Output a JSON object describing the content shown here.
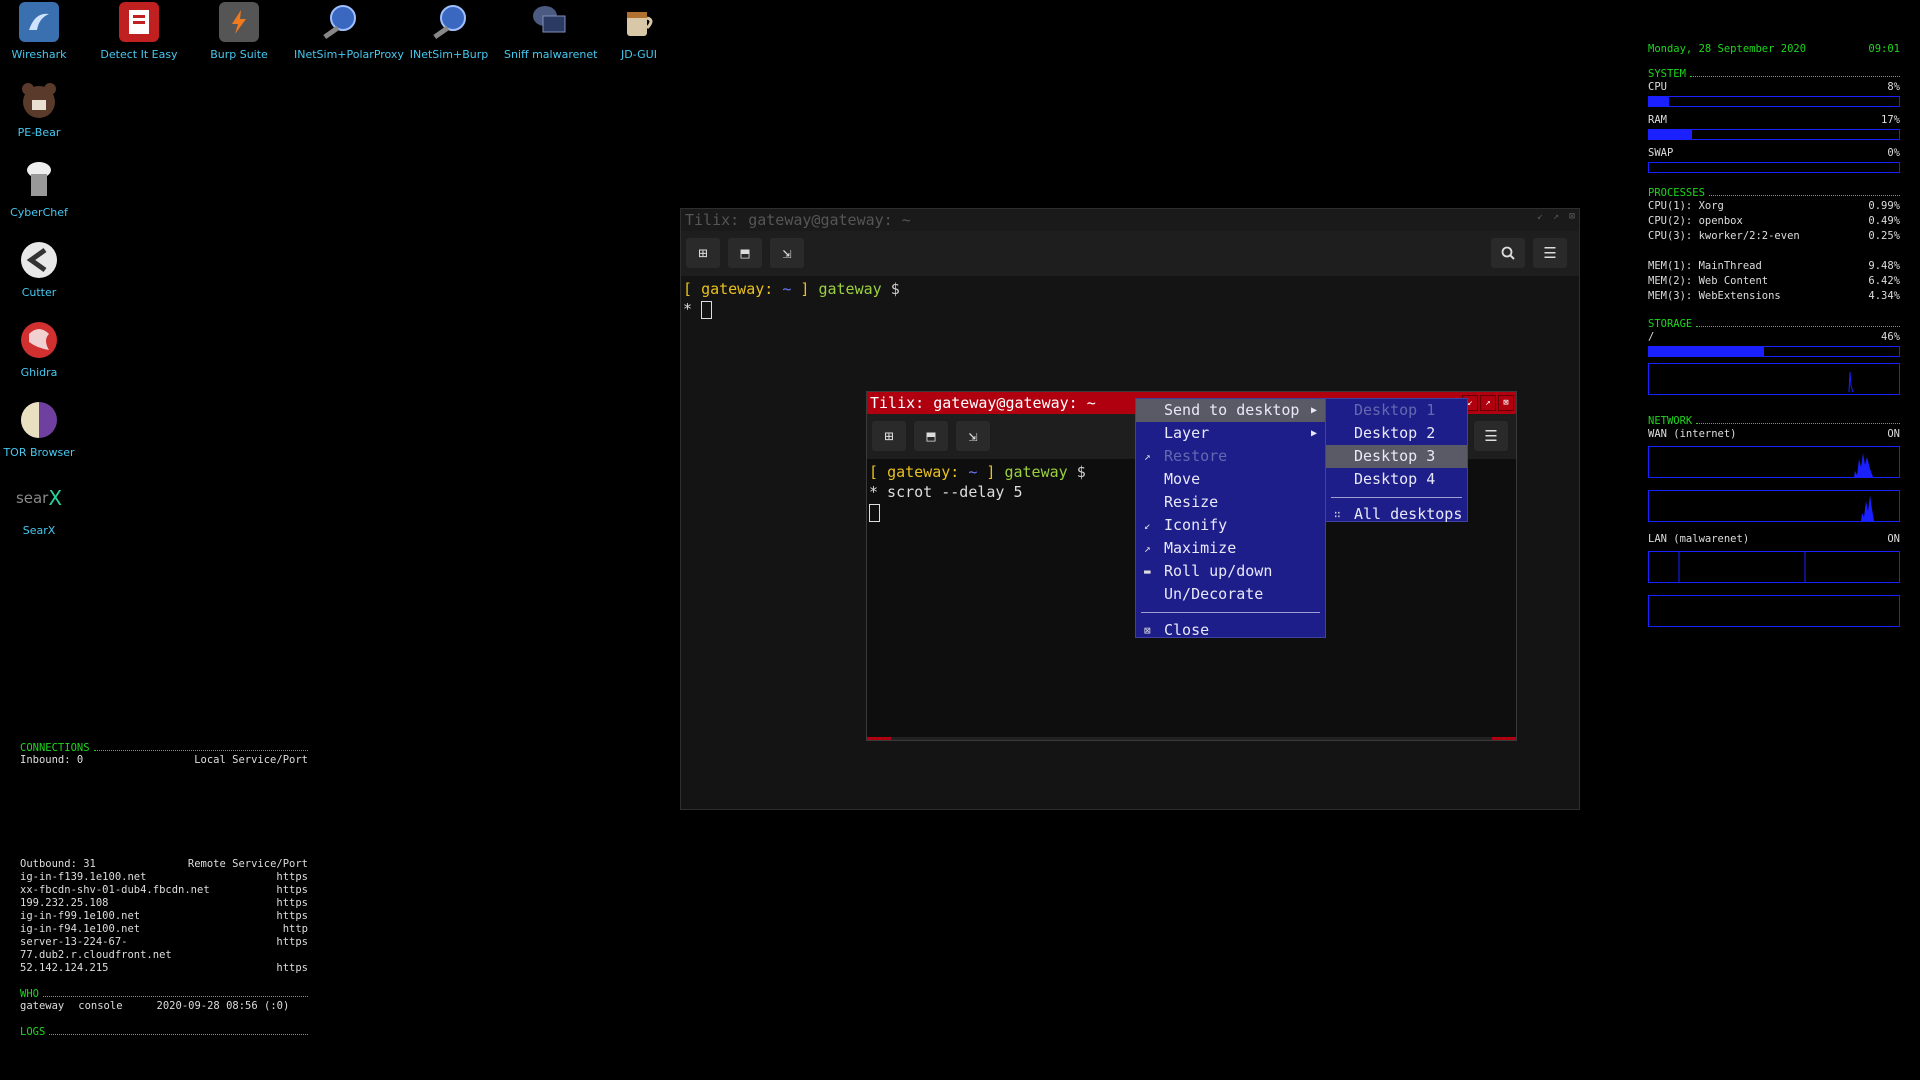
{
  "desktop_icons": [
    {
      "label": "Wireshark",
      "icon": "wireshark-icon",
      "color": "#3a6fb0"
    },
    {
      "label": "Detect It Easy",
      "icon": "die-icon",
      "color": "#c02020"
    },
    {
      "label": "Burp Suite",
      "icon": "burp-icon",
      "color": "#e07020"
    },
    {
      "label": "INetSim+PolarProxy",
      "icon": "inetsim-polar-icon",
      "color": "#4a70c0"
    },
    {
      "label": "INetSim+Burp",
      "icon": "inetsim-burp-icon",
      "color": "#4a70c0"
    },
    {
      "label": "Sniff malwarenet",
      "icon": "sniff-icon",
      "color": "#3a5a90"
    },
    {
      "label": "JD-GUI",
      "icon": "jdgui-icon",
      "color": "#c08040"
    },
    {
      "label": "PE-Bear",
      "icon": "pebear-icon",
      "color": "#6a3020"
    },
    {
      "label": "CyberChef",
      "icon": "cyberchef-icon",
      "color": "#808080"
    },
    {
      "label": "Cutter",
      "icon": "cutter-icon",
      "color": "#e0e0e0"
    },
    {
      "label": "Ghidra",
      "icon": "ghidra-icon",
      "color": "#d03030"
    },
    {
      "label": "TOR Browser",
      "icon": "tor-icon",
      "color": "#7040a0"
    },
    {
      "label": "SearX",
      "icon": "searx-icon",
      "color": "#000000"
    }
  ],
  "conky_left": {
    "connections_title": "CONNECTIONS",
    "inbound_label": "Inbound: 0",
    "local_service_label": "Local Service/Port",
    "outbound_label": "Outbound: 31",
    "remote_service_label": "Remote Service/Port",
    "connections": [
      {
        "host": "ig-in-f139.1e100.net",
        "svc": "https"
      },
      {
        "host": "xx-fbcdn-shv-01-dub4.fbcdn.net",
        "svc": "https"
      },
      {
        "host": "199.232.25.108",
        "svc": "https"
      },
      {
        "host": "ig-in-f99.1e100.net",
        "svc": "https"
      },
      {
        "host": "ig-in-f94.1e100.net",
        "svc": "http"
      },
      {
        "host": "server-13-224-67-77.dub2.r.cloudfront.net",
        "svc": "https"
      },
      {
        "host": "52.142.124.215",
        "svc": "https"
      }
    ],
    "who_title": "WHO",
    "who_user": "gateway",
    "who_tty": "console",
    "who_time": "2020-09-28 08:56 (:0)",
    "logs_title": "LOGS"
  },
  "conky_right": {
    "date": "Monday, 28 September 2020",
    "time": "09:01",
    "system_title": "SYSTEM",
    "cpu_label": "CPU",
    "cpu_value": "8%",
    "cpu_fraction": 0.08,
    "ram_label": "RAM",
    "ram_value": "17%",
    "ram_fraction": 0.17,
    "swap_label": "SWAP",
    "swap_value": "0%",
    "swap_fraction": 0.0,
    "processes_title": "PROCESSES",
    "cpu_procs": [
      {
        "name": "CPU(1): Xorg",
        "val": "0.99%"
      },
      {
        "name": "CPU(2): openbox",
        "val": "0.49%"
      },
      {
        "name": "CPU(3): kworker/2:2-even",
        "val": "0.25%"
      }
    ],
    "mem_procs": [
      {
        "name": "MEM(1): MainThread",
        "val": "9.48%"
      },
      {
        "name": "MEM(2): Web Content",
        "val": "6.42%"
      },
      {
        "name": "MEM(3): WebExtensions",
        "val": "4.34%"
      }
    ],
    "storage_title": "STORAGE",
    "root_label": "/",
    "root_value": "46%",
    "root_fraction": 0.46,
    "network_title": "NETWORK",
    "wan_label": "WAN (internet)",
    "wan_status": "ON",
    "lan_label": "LAN (malwarenet)",
    "lan_status": "ON"
  },
  "back_window": {
    "title": "Tilix: gateway@gateway: ~",
    "prompt_open": "[",
    "prompt_host": "gateway:",
    "prompt_path": "~",
    "prompt_close": "]",
    "prompt_user": "gateway",
    "prompt_sign": "$",
    "line2_star": "*"
  },
  "front_window": {
    "title": "Tilix: gateway@gateway: ~",
    "prompt_open": "[",
    "prompt_host": "gateway:",
    "prompt_path": "~",
    "prompt_close": "]",
    "prompt_user": "gateway",
    "prompt_sign": "$",
    "command": "* scrot --delay 5"
  },
  "context_menu": {
    "items": [
      {
        "label": "Send to desktop",
        "mark": "",
        "disabled": false,
        "submenu": true
      },
      {
        "label": "Layer",
        "mark": "",
        "disabled": false,
        "submenu": true
      },
      {
        "label": "Restore",
        "mark": "↗",
        "disabled": true,
        "submenu": false
      },
      {
        "label": "Move",
        "mark": "",
        "disabled": false,
        "submenu": false
      },
      {
        "label": "Resize",
        "mark": "",
        "disabled": false,
        "submenu": false
      },
      {
        "label": "Iconify",
        "mark": "↙",
        "disabled": false,
        "submenu": false
      },
      {
        "label": "Maximize",
        "mark": "↗",
        "disabled": false,
        "submenu": false
      },
      {
        "label": "Roll up/down",
        "mark": "▬",
        "disabled": false,
        "submenu": false
      }
    ],
    "undecorate": "Un/Decorate",
    "close": "Close",
    "close_mark": "⊠"
  },
  "desktop_submenu": {
    "items": [
      "Desktop 1",
      "Desktop 2",
      "Desktop 3",
      "Desktop 4"
    ],
    "all": "All desktops"
  },
  "colors": {
    "conky_green": "#1ed61e",
    "conky_blue": "#1a20ff",
    "focused_titlebar": "#b00010",
    "menu_bg": "#1e1e8a",
    "menu_selected": "#5a5a66",
    "prompt_yellow": "#e8c020",
    "prompt_blue": "#6a7aff",
    "prompt_green": "#9ad040"
  }
}
